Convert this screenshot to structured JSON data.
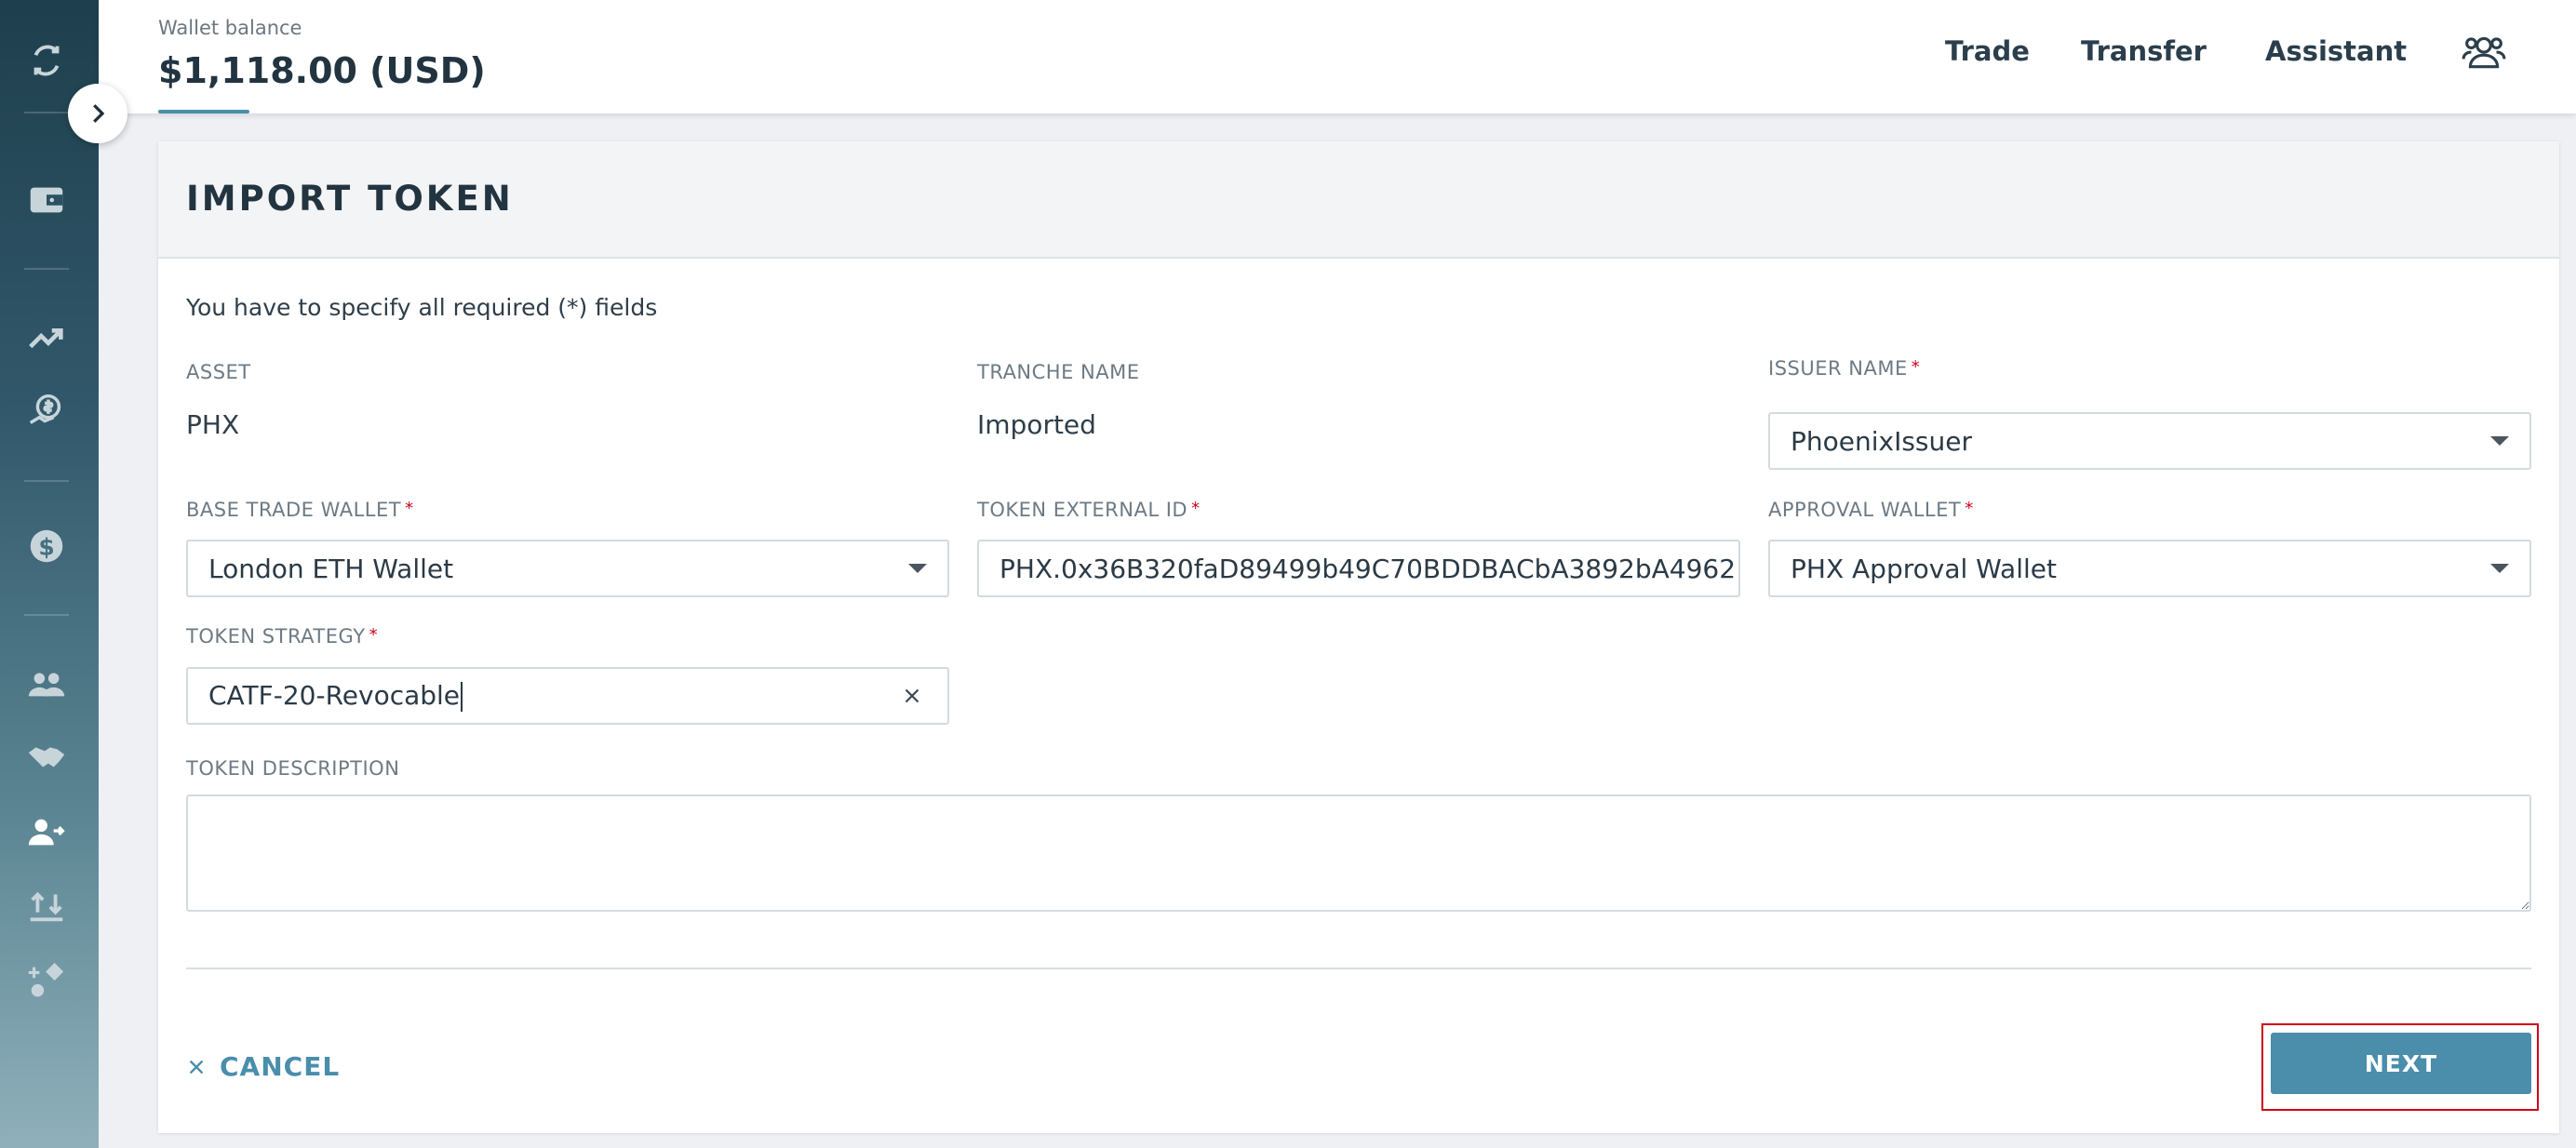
{
  "header": {
    "wallet_balance_label": "Wallet balance",
    "wallet_balance_value": "$1,118.00 (USD)",
    "nav": {
      "trade": "Trade",
      "transfer": "Transfer",
      "assistant": "Assistant"
    }
  },
  "sidebar": {
    "icons": [
      "logo-icon",
      "wallet-icon",
      "chart-trend-icon",
      "dollar-tag-icon",
      "dollar-coin-icon",
      "people-icon",
      "handshake-icon",
      "user-transfer-icon",
      "import-icon",
      "shapes-icon"
    ]
  },
  "card": {
    "title": "IMPORT TOKEN",
    "required_note": "You have to specify all required (*) fields",
    "fields": {
      "asset": {
        "label": "ASSET",
        "value": "PHX"
      },
      "tranche_name": {
        "label": "TRANCHE NAME",
        "value": "Imported"
      },
      "issuer_name": {
        "label": "ISSUER NAME",
        "value": "PhoenixIssuer"
      },
      "base_trade_wallet": {
        "label": "BASE TRADE WALLET",
        "value": "London ETH Wallet"
      },
      "token_external_id": {
        "label": "TOKEN EXTERNAL ID",
        "value": "PHX.0x36B320faD89499b49C70BDDBACbA3892bA4962"
      },
      "approval_wallet": {
        "label": "APPROVAL WALLET",
        "value": "PHX Approval Wallet"
      },
      "token_strategy": {
        "label": "TOKEN STRATEGY",
        "value": "CATF-20-Revocable"
      },
      "token_description": {
        "label": "TOKEN DESCRIPTION",
        "value": ""
      }
    },
    "required_mark": "*",
    "cancel_label": "CANCEL",
    "next_label": "NEXT"
  },
  "colors": {
    "accent": "#4a8eab",
    "required": "#d0021b",
    "highlight": "#d0021b"
  }
}
